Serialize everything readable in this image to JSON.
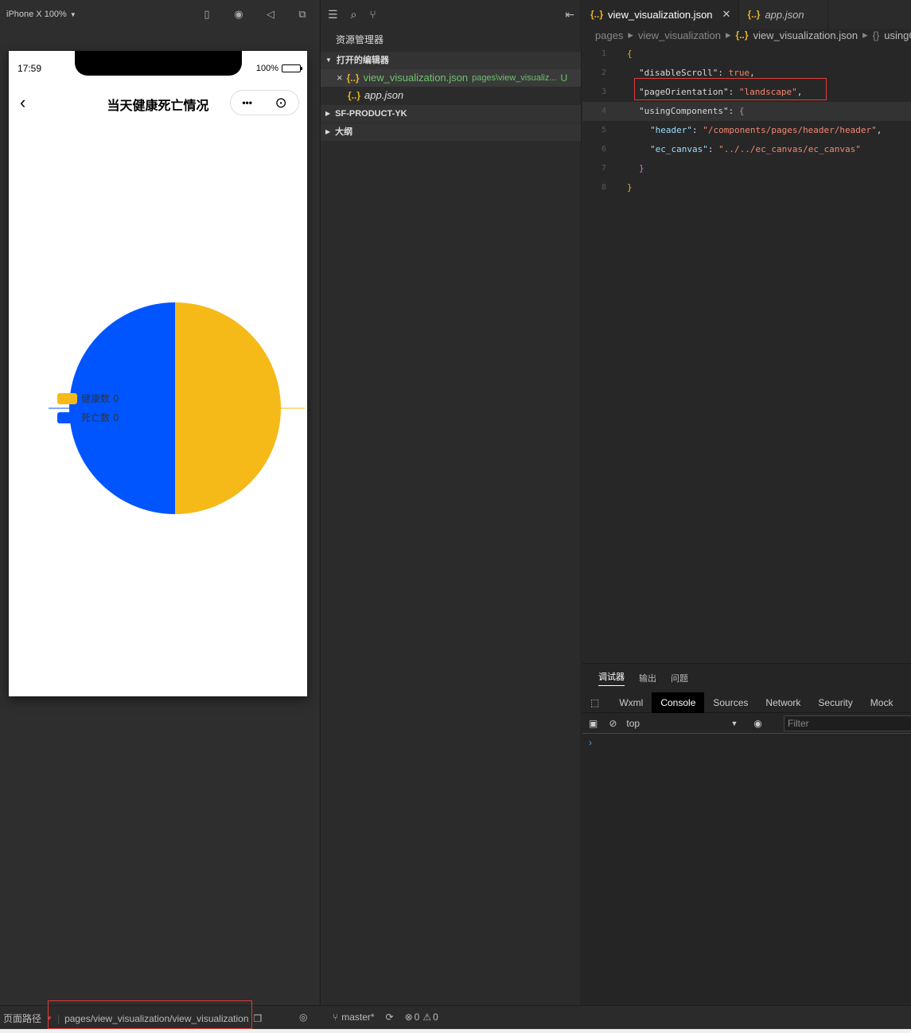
{
  "simulator": {
    "device_label": "iPhone X 100%",
    "status_time": "17:59",
    "battery_pct": "100%",
    "page_title": "当天健康死亡情况",
    "capsule_more": "•••"
  },
  "chart_data": {
    "type": "pie",
    "categories": [
      "健康数",
      "死亡数"
    ],
    "values": [
      1,
      1
    ],
    "legend": [
      {
        "label": "健康数 0",
        "color": "#f5b918"
      },
      {
        "label": "死亡数 0",
        "color": "#0055ff"
      }
    ],
    "colors": {
      "healthy": "#f5b918",
      "death": "#0055ff"
    }
  },
  "explorer": {
    "title": "资源管理器",
    "open_editors_label": "打开的编辑器",
    "open_files": [
      {
        "name": "view_visualization.json",
        "path": "pages\\view_visualiz...",
        "badge": "U"
      },
      {
        "name": "app.json"
      }
    ],
    "project_label": "SF-PRODUCT-YK",
    "outline_label": "大纲"
  },
  "editor": {
    "tabs": [
      {
        "label": "view_visualization.json"
      },
      {
        "label": "app.json"
      }
    ],
    "breadcrumb": [
      "pages",
      "view_visualization",
      "view_visualization.json",
      "usingCo"
    ],
    "lines": {
      "l1": "{",
      "l2k": "\"disableScroll\"",
      "l2v": "true",
      "l3k": "\"pageOrientation\"",
      "l3v": "\"landscape\"",
      "l4k": "\"usingComponents\"",
      "l5k": "\"header\"",
      "l5v": "\"/components/pages/header/header\"",
      "l6k": "\"ec_canvas\"",
      "l6v": "\"../../ec_canvas/ec_canvas\"",
      "l7": "}",
      "l8": "}"
    }
  },
  "debugger": {
    "tabs": [
      "调试器",
      "输出",
      "问题"
    ],
    "dev_tabs": [
      "Wxml",
      "Console",
      "Sources",
      "Network",
      "Security",
      "Mock"
    ],
    "context": "top",
    "filter_placeholder": "Filter",
    "prompt": "›"
  },
  "statusbar": {
    "route_label": "页面路径",
    "route_value": "pages/view_visualization/view_visualization",
    "branch": "master*",
    "errors": "0",
    "warnings": "0"
  }
}
